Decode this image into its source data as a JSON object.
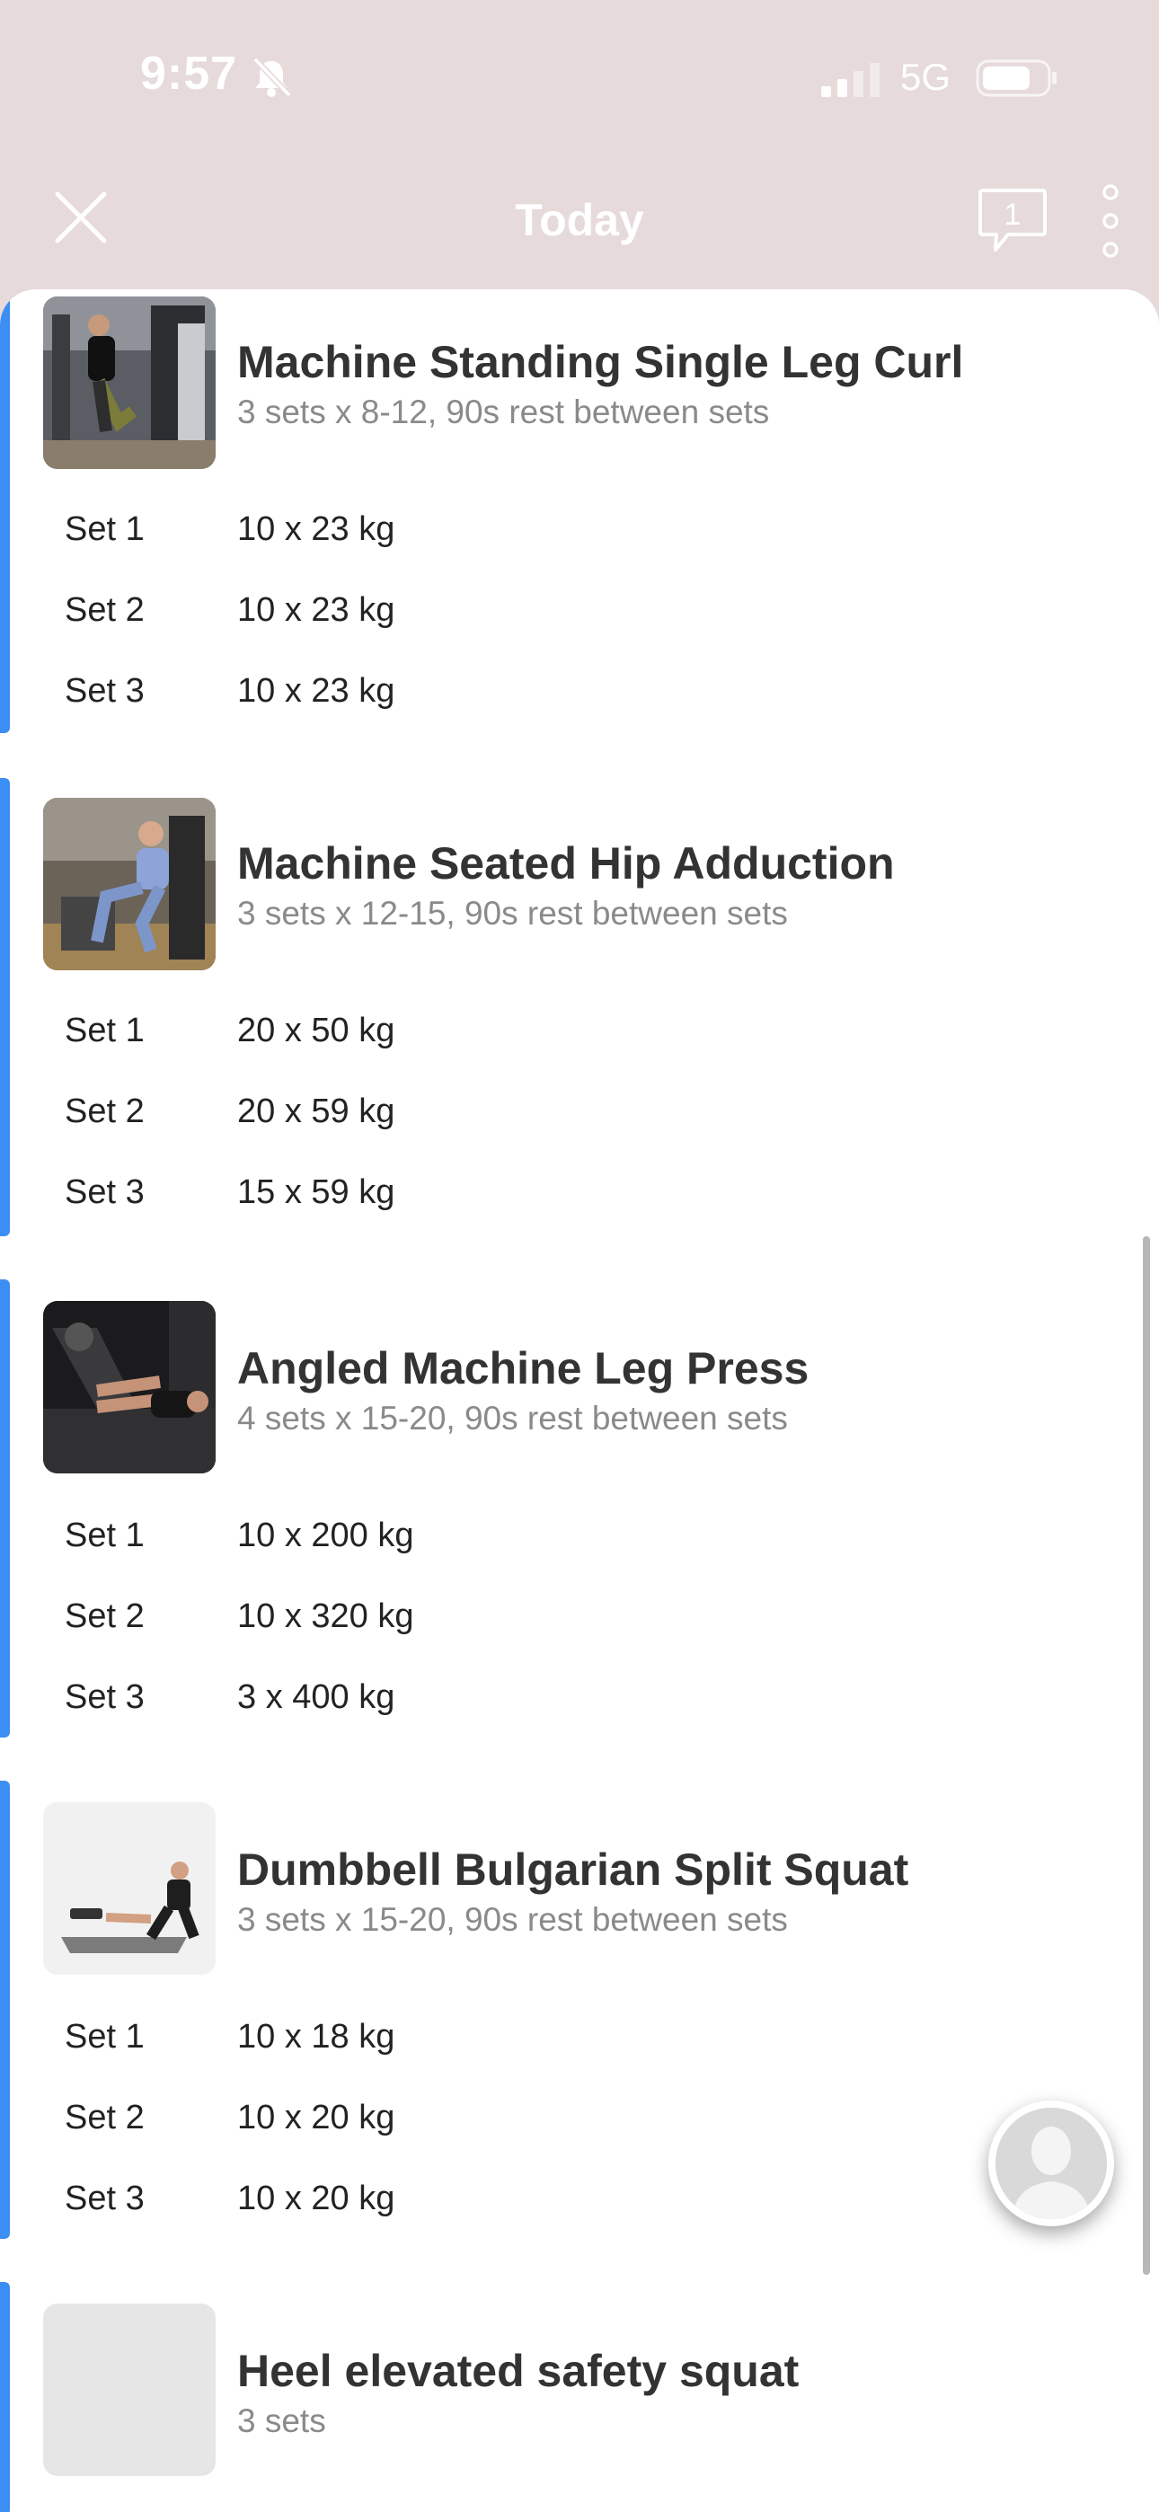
{
  "status_bar": {
    "time": "9:57",
    "network": "5G",
    "icons": [
      "bell-slash-icon",
      "signal-icon",
      "battery-icon"
    ]
  },
  "header": {
    "title": "Today",
    "chat_count": "1",
    "icons": [
      "close-icon",
      "chat-icon",
      "more-vertical-icon"
    ]
  },
  "colors": {
    "header_bg": "#e6dadb",
    "accent": "#3c8ef3",
    "title_text": "#333333",
    "detail_text": "#8a8a8a"
  },
  "exercises": [
    {
      "name": "Machine Standing Single Leg Curl",
      "detail": "3 sets x 8-12, 90s rest between sets",
      "sets": [
        {
          "label": "Set 1",
          "value": "10 x 23 kg"
        },
        {
          "label": "Set 2",
          "value": "10 x 23 kg"
        },
        {
          "label": "Set 3",
          "value": "10 x 23 kg"
        }
      ]
    },
    {
      "name": "Machine Seated Hip Adduction",
      "detail": "3 sets x 12-15, 90s rest between sets",
      "sets": [
        {
          "label": "Set 1",
          "value": "20 x 50 kg"
        },
        {
          "label": "Set 2",
          "value": "20 x 59 kg"
        },
        {
          "label": "Set 3",
          "value": "15 x 59 kg"
        }
      ]
    },
    {
      "name": "Angled Machine Leg Press",
      "detail": "4 sets x 15-20, 90s rest between sets",
      "sets": [
        {
          "label": "Set 1",
          "value": "10 x 200 kg"
        },
        {
          "label": "Set 2",
          "value": "10 x 320 kg"
        },
        {
          "label": "Set 3",
          "value": "3 x 400 kg"
        }
      ]
    },
    {
      "name": "Dumbbell Bulgarian Split Squat",
      "detail": "3 sets x 15-20, 90s rest between sets",
      "sets": [
        {
          "label": "Set 1",
          "value": "10 x 18 kg"
        },
        {
          "label": "Set 2",
          "value": "10 x 20 kg"
        },
        {
          "label": "Set 3",
          "value": "10 x 20 kg"
        }
      ]
    },
    {
      "name": "Heel elevated safety squat",
      "detail": "3 sets",
      "sets": []
    }
  ]
}
